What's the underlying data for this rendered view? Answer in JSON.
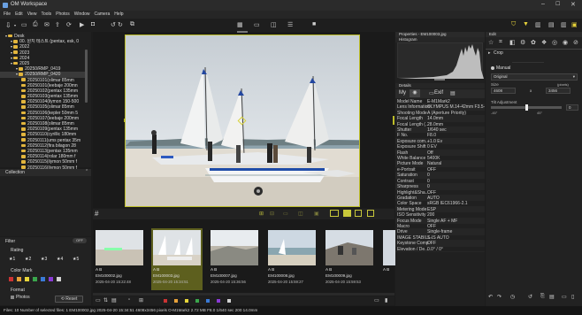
{
  "app": {
    "title": "OM Workspace"
  },
  "menu": [
    "File",
    "Edit",
    "View",
    "Tools",
    "Photos",
    "Window",
    "Camera",
    "Help"
  ],
  "tree": {
    "items": [
      {
        "label": "Desk",
        "indent": 1
      },
      {
        "label": "00. 원지 테스트 (pentax, esk, 0",
        "indent": 2
      },
      {
        "label": "2022",
        "indent": 2
      },
      {
        "label": "2023",
        "indent": 2
      },
      {
        "label": "2024",
        "indent": 2
      },
      {
        "label": "2025",
        "indent": 2
      },
      {
        "label": "20250/RMP_0419",
        "indent": 3
      },
      {
        "label": "20250/RMP_0420",
        "indent": 3
      },
      {
        "label": "20250101(olimar 85mm",
        "indent": 4
      },
      {
        "label": "20250101(leebaje 200mn",
        "indent": 4
      },
      {
        "label": "20250102(pentax 135mm",
        "indent": 4
      },
      {
        "label": "20250103(pentax 135mm",
        "indent": 4
      },
      {
        "label": "20250104(ilymon 150-500",
        "indent": 4
      },
      {
        "label": "20250105(olimar 85mm",
        "indent": 4
      },
      {
        "label": "20250106(kepler 50mm 5",
        "indent": 4
      },
      {
        "label": "20250107(leebaje 200mm",
        "indent": 4
      },
      {
        "label": "20250108(olimar 85mm",
        "indent": 4
      },
      {
        "label": "20250109(pentax 135mm",
        "indent": 4
      },
      {
        "label": "20250110(cyrillic 180mm",
        "indent": 4
      },
      {
        "label": "20250111(ums pentax 35m",
        "indent": 4
      },
      {
        "label": "20250112(fira bilagon 28",
        "indent": 4
      },
      {
        "label": "20250113(pentax 135mm",
        "indent": 4
      },
      {
        "label": "20250114(rolar 180mm f",
        "indent": 4
      },
      {
        "label": "20250115(ilymon 50mm f",
        "indent": 4
      },
      {
        "label": "20250116(ilymon 50mm f",
        "indent": 4
      },
      {
        "label": "20250117(exakta 135mm",
        "indent": 4
      }
    ]
  },
  "collection": {
    "header": "Collection"
  },
  "filter": {
    "header": "Filter",
    "toggle": "OFF",
    "rating_label": "Rating",
    "stars": [
      "1",
      "2",
      "3",
      "4",
      "5"
    ],
    "color_mark_label": "Color Mark",
    "format_label": "Format",
    "format_photos": "Photos",
    "reset_label": "Reset",
    "swatch_colors": [
      "#cc3333",
      "#e8a23a",
      "#e7d63a",
      "#3aa64c",
      "#3a7ad6",
      "#8a3ad6",
      "#d2d2d2"
    ]
  },
  "center_toolbar": {
    "labels": [
      "",
      "",
      ""
    ]
  },
  "thumbnails": [
    {
      "ab": "A B",
      "name": "EM100002.jpg",
      "date": "2025-04-20 15:22:48",
      "selected": false
    },
    {
      "ab": "A B",
      "name": "EM100003.jpg",
      "date": "2025-04-20 15:34:51",
      "selected": true
    },
    {
      "ab": "A B",
      "name": "EM100007.jpg",
      "date": "2025-04-20 15:36:56",
      "selected": false
    },
    {
      "ab": "A B",
      "name": "EM100008.jpg",
      "date": "2025-04-20 15:59:27",
      "selected": false
    },
    {
      "ab": "A B",
      "name": "EM100009.jpg",
      "date": "2025-04-20 15:59:53",
      "selected": false
    },
    {
      "ab": "A B",
      "name": "",
      "date": "",
      "selected": false
    }
  ],
  "statusbar": {
    "text": "Files: 10 Number of selected files: 1  EM100002.jpg 2025-04-20 15:34:51 4608x3456 pixels O-M1Mark2 2.72 MB F8.0 1/640 sec 200 14.0mm"
  },
  "properties": {
    "title": "Properties - EM100003.jpg",
    "histogram_label": "Histogram",
    "details_label": "Details",
    "tabs": [
      "My",
      "",
      "Exif",
      ""
    ],
    "rows": [
      [
        "Model Name",
        "E-M1Mark2"
      ],
      [
        "Lens Information",
        "OLYMPUS M.14-42mm F3.5-5.6"
      ],
      [
        "Shooting Mode",
        "A (Aperture Priority)"
      ],
      [
        "Focal Length",
        "14.0mm"
      ],
      [
        "Focal Length (...",
        "28.0mm"
      ],
      [
        "Shutter",
        "1/640 sec"
      ],
      [
        "F No.",
        "F8.0"
      ],
      [
        "Exposure com...",
        "+1.0 Ev"
      ],
      [
        "Exposure Shift",
        "0 EV"
      ],
      [
        "Flash",
        "Off"
      ],
      [
        "White Balance",
        "5400K"
      ],
      [
        "Picture Mode",
        "Natural"
      ],
      [
        "e-Portrait",
        "OFF"
      ],
      [
        "Saturation",
        "0"
      ],
      [
        "Contrast",
        "0"
      ],
      [
        "Sharpness",
        "0"
      ],
      [
        "Highlight&Sha...",
        "OFF"
      ],
      [
        "Gradation",
        "AUTO"
      ],
      [
        "Color Space",
        "sRGB IEC61966-2.1"
      ],
      [
        "Metering Mode",
        "ESP"
      ],
      [
        "ISO Sensitivity",
        "200"
      ],
      [
        "Focus Mode",
        "Single AF + MF"
      ],
      [
        "Macro",
        "OFF"
      ],
      [
        "Drive",
        "Single-frame"
      ],
      [
        "IMAGE STABILI...",
        "S-IS AUTO"
      ],
      [
        "Keystone Comp",
        "OFF"
      ],
      [
        "Elevation / De...",
        "0.0° / 0°"
      ]
    ]
  },
  "edit": {
    "title": "Edit",
    "crop_label": "Crop",
    "manual_label": "Manual",
    "original_label": "Original",
    "size_label": "Size",
    "width": "4608",
    "height": "3456",
    "x_label": "x",
    "width_unit": "(pixels)",
    "tilt_label": "Tilt Adjustment",
    "tilt_min": "-45°",
    "tilt_max": "45°",
    "tilt_value": "0",
    "tilt_fraction": 0.5
  }
}
